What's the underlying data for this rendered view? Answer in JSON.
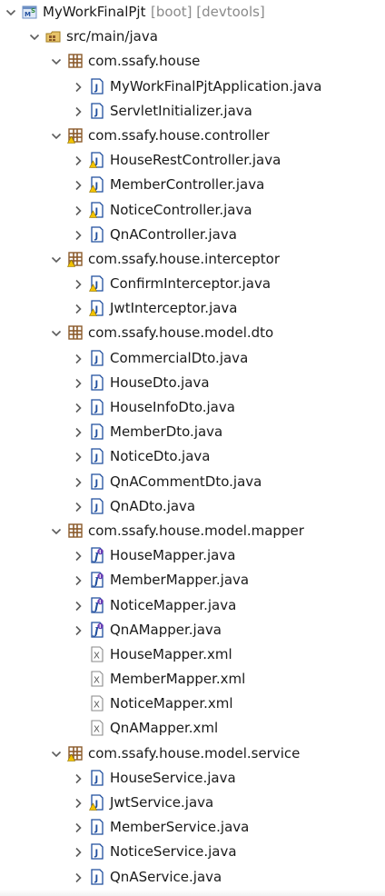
{
  "project": {
    "name": "MyWorkFinalPjt",
    "decorations": "[boot] [devtools]",
    "icon": "spring-project-icon",
    "expanded": true
  },
  "source_folder": {
    "name": "src/main/java",
    "icon": "source-folder-icon",
    "expanded": true
  },
  "packages": [
    {
      "name": "com.ssafy.house",
      "icon": "package-icon",
      "expanded": true,
      "files": [
        {
          "name": "MyWorkFinalPjtApplication.java",
          "icon": "java-class-icon",
          "collapsible": true
        },
        {
          "name": "ServletInitializer.java",
          "icon": "java-class-icon",
          "collapsible": true
        }
      ]
    },
    {
      "name": "com.ssafy.house.controller",
      "icon": "package-warning-icon",
      "expanded": true,
      "files": [
        {
          "name": "HouseRestController.java",
          "icon": "java-class-warning-icon",
          "collapsible": true
        },
        {
          "name": "MemberController.java",
          "icon": "java-class-warning-icon",
          "collapsible": true
        },
        {
          "name": "NoticeController.java",
          "icon": "java-class-warning-icon",
          "collapsible": true
        },
        {
          "name": "QnAController.java",
          "icon": "java-class-icon",
          "collapsible": true
        }
      ]
    },
    {
      "name": "com.ssafy.house.interceptor",
      "icon": "package-warning-icon",
      "expanded": true,
      "files": [
        {
          "name": "ConfirmInterceptor.java",
          "icon": "java-class-warning-icon",
          "collapsible": true
        },
        {
          "name": "JwtInterceptor.java",
          "icon": "java-class-warning-icon",
          "collapsible": true
        }
      ]
    },
    {
      "name": "com.ssafy.house.model.dto",
      "icon": "package-icon",
      "expanded": true,
      "files": [
        {
          "name": "CommercialDto.java",
          "icon": "java-class-icon",
          "collapsible": true
        },
        {
          "name": "HouseDto.java",
          "icon": "java-class-icon",
          "collapsible": true
        },
        {
          "name": "HouseInfoDto.java",
          "icon": "java-class-icon",
          "collapsible": true
        },
        {
          "name": "MemberDto.java",
          "icon": "java-class-icon",
          "collapsible": true
        },
        {
          "name": "NoticeDto.java",
          "icon": "java-class-icon",
          "collapsible": true
        },
        {
          "name": "QnACommentDto.java",
          "icon": "java-class-icon",
          "collapsible": true
        },
        {
          "name": "QnADto.java",
          "icon": "java-class-icon",
          "collapsible": true
        }
      ]
    },
    {
      "name": "com.ssafy.house.model.mapper",
      "icon": "package-icon",
      "expanded": true,
      "files": [
        {
          "name": "HouseMapper.java",
          "icon": "java-interface-icon",
          "collapsible": true
        },
        {
          "name": "MemberMapper.java",
          "icon": "java-interface-icon",
          "collapsible": true
        },
        {
          "name": "NoticeMapper.java",
          "icon": "java-interface-icon",
          "collapsible": true
        },
        {
          "name": "QnAMapper.java",
          "icon": "java-interface-icon",
          "collapsible": true
        },
        {
          "name": "HouseMapper.xml",
          "icon": "xml-file-icon",
          "collapsible": false
        },
        {
          "name": "MemberMapper.xml",
          "icon": "xml-file-icon",
          "collapsible": false
        },
        {
          "name": "NoticeMapper.xml",
          "icon": "xml-file-icon",
          "collapsible": false
        },
        {
          "name": "QnAMapper.xml",
          "icon": "xml-file-icon",
          "collapsible": false
        }
      ]
    },
    {
      "name": "com.ssafy.house.model.service",
      "icon": "package-warning-icon",
      "expanded": true,
      "files": [
        {
          "name": "HouseService.java",
          "icon": "java-class-icon",
          "collapsible": true
        },
        {
          "name": "JwtService.java",
          "icon": "java-class-warning-icon",
          "collapsible": true
        },
        {
          "name": "MemberService.java",
          "icon": "java-class-icon",
          "collapsible": true
        },
        {
          "name": "NoticeService.java",
          "icon": "java-class-icon",
          "collapsible": true
        },
        {
          "name": "QnAService.java",
          "icon": "java-class-icon",
          "collapsible": true
        }
      ]
    }
  ],
  "colors": {
    "text": "#1a1a1a",
    "decoration": "#8a8a8a",
    "chevron": "#5c5c5c",
    "package_brown": "#8b5a2b",
    "java_blue": "#1f4e9e",
    "warning_yellow": "#f2c200",
    "xml_gray": "#555555"
  }
}
